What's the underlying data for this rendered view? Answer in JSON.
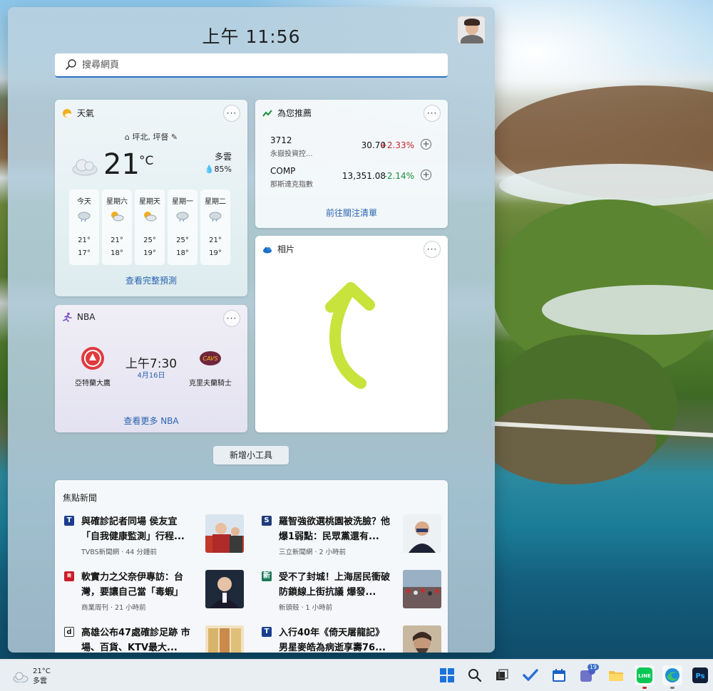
{
  "clock": {
    "time": "上午 11:56"
  },
  "search": {
    "placeholder": "搜尋網頁"
  },
  "weather": {
    "title": "天氣",
    "location": "坪北, 坪督",
    "temp": "21",
    "unit": "°C",
    "condition": "多雲",
    "humidity": "85%",
    "forecast": [
      {
        "day": "今天",
        "hi": "21°",
        "lo": "17°",
        "icon": "rain-cloud-icon"
      },
      {
        "day": "星期六",
        "hi": "21°",
        "lo": "18°",
        "icon": "partly-sunny-icon"
      },
      {
        "day": "星期天",
        "hi": "25°",
        "lo": "19°",
        "icon": "partly-sunny-icon"
      },
      {
        "day": "星期一",
        "hi": "25°",
        "lo": "18°",
        "icon": "rain-cloud-icon"
      },
      {
        "day": "星期二",
        "hi": "21°",
        "lo": "19°",
        "icon": "rain-cloud-icon"
      }
    ],
    "link": "查看完整預測"
  },
  "stocks": {
    "title": "為您推薦",
    "rows": [
      {
        "symbol": "3712",
        "name": "永嶽投資控...",
        "price": "30.70",
        "change": "+2.33%",
        "dir": "up"
      },
      {
        "symbol": "COMP",
        "name": "那斯達克指數",
        "price": "13,351.08",
        "change": "-2.14%",
        "dir": "down"
      }
    ],
    "link": "前往關注清單"
  },
  "photos": {
    "title": "相片"
  },
  "nba": {
    "title": "NBA",
    "home": "亞特蘭大鷹",
    "away": "克里夫蘭騎士",
    "time": "上午7:30",
    "date": "4月16日",
    "link": "查看更多 NBA"
  },
  "add_widget": "新增小工具",
  "news": {
    "title": "焦點新聞",
    "items": [
      {
        "headline": "與確診記者同場 侯友宜「自我健康監測」行程...",
        "source": "TVBS新聞網 · 44 分鐘前",
        "src_letter": "T",
        "src_color": "#1b3d8f"
      },
      {
        "headline": "羅智強欲選桃園被洗臉？他爆1弱點：民眾黨還有...",
        "source": "三立新聞網 · 2 小時前",
        "src_letter": "S",
        "src_color": "#1f3d7a"
      },
      {
        "headline": "軟實力之父奈伊專訪：台灣，要讓自己當「毒蝦」",
        "source": "商業周刊 · 21 小時前",
        "src_letter": "商",
        "src_color": "#c81e2b"
      },
      {
        "headline": "受不了封城！上海居民衝破防鎖線上街抗議 爆發...",
        "source": "新頭殼 · 1 小時前",
        "src_letter": "新",
        "src_color": "#1e7a5a"
      },
      {
        "headline": "高雄公布47處確診足跡 市場、百貨、KTV最大...",
        "source": "",
        "src_letter": "d",
        "src_color": "#222222"
      },
      {
        "headline": "入行40年《倚天屠龍記》男星麥皓為病逝享壽76...",
        "source": "",
        "src_letter": "T",
        "src_color": "#1b3d8f"
      }
    ]
  },
  "taskbar": {
    "weather_temp": "21°C",
    "weather_cond": "多雲",
    "teams_badge": "19"
  }
}
